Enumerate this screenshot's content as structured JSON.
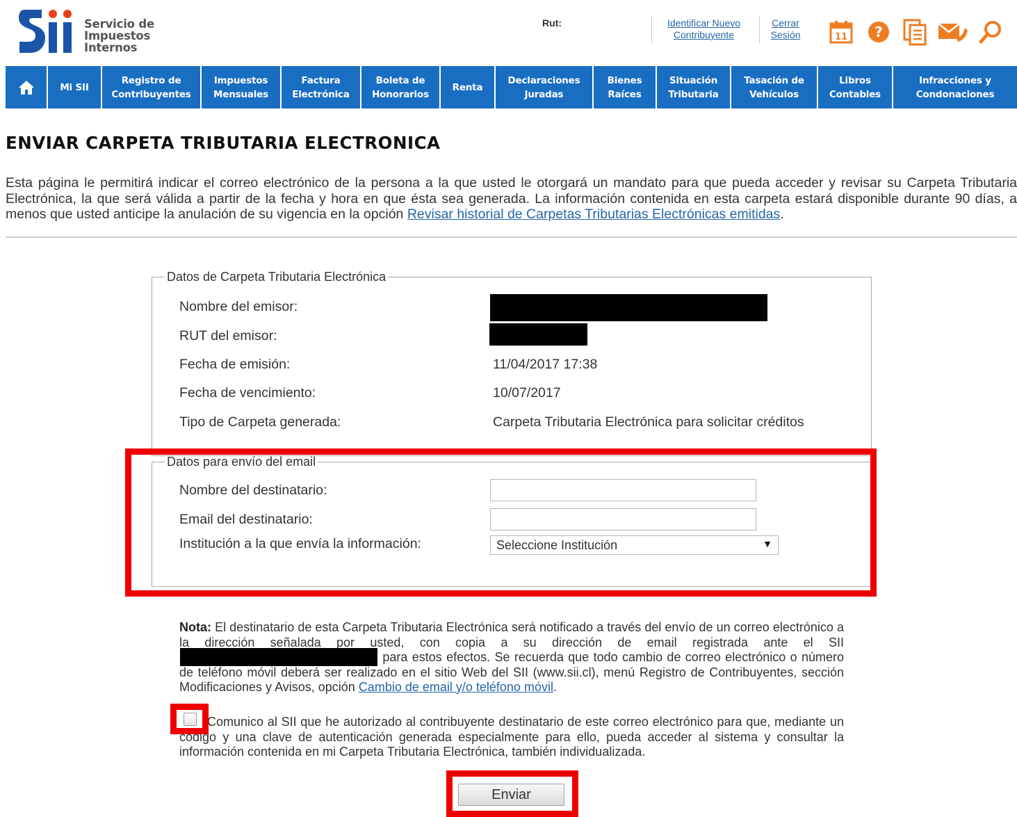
{
  "header": {
    "logo_text": [
      "Servicio de",
      "Impuestos",
      "Internos"
    ],
    "rut_label": "Rut:",
    "identify_link": [
      "Identificar Nuevo",
      "Contribuyente"
    ],
    "logout_link": [
      "Cerrar",
      "Sesión"
    ],
    "icons": [
      "calendar-icon",
      "help-icon",
      "documents-icon",
      "mail-icon",
      "search-icon"
    ],
    "icon_color": "#ee7d22"
  },
  "nav": {
    "color": "#1a6ec1",
    "items": [
      {
        "label": "",
        "icon": "home-icon"
      },
      {
        "label": "Mi SII"
      },
      {
        "label": "Registro de\nContribuyentes"
      },
      {
        "label": "Impuestos\nMensuales"
      },
      {
        "label": "Factura\nElectrónica"
      },
      {
        "label": "Boleta de\nHonorarios"
      },
      {
        "label": "Renta"
      },
      {
        "label": "Declaraciones\nJuradas"
      },
      {
        "label": "Bienes\nRaíces"
      },
      {
        "label": "Situación\nTributaria"
      },
      {
        "label": "Tasación de\nVehículos"
      },
      {
        "label": "Libros\nContables"
      },
      {
        "label": "Infracciones y\nCondonaciones"
      }
    ]
  },
  "page": {
    "title": "ENVIAR CARPETA TRIBUTARIA ELECTRONICA",
    "intro_text": "Esta página le permitirá indicar el correo electrónico de la persona a la que usted le otorgará un mandato para que pueda acceder y revisar su Carpeta Tributaria Electrónica, la que será válida a partir de la fecha y hora en que ésta sea generada. La información contenida en esta carpeta estará disponible durante 90 días, a menos que usted anticipe la anulación de su vigencia en la opción ",
    "intro_link": "Revisar historial de Carpetas Tributarias Electrónicas emitidas",
    "intro_end": "."
  },
  "carpeta": {
    "legend": "Datos de Carpeta Tributaria Electrónica",
    "emisor_label": "Nombre del emisor:",
    "rut_label": "RUT del emisor:",
    "fecha_emision_label": "Fecha de emisión:",
    "fecha_emision": "11/04/2017 17:38",
    "fecha_venc_label": "Fecha de vencimiento:",
    "fecha_venc": "10/07/2017",
    "tipo_label": "Tipo de Carpeta generada:",
    "tipo": "Carpeta Tributaria Electrónica para solicitar créditos"
  },
  "email": {
    "legend": "Datos para envío del email",
    "nombre_label": "Nombre del destinatario:",
    "nombre_value": "",
    "email_label": "Email del destinatario:",
    "email_value": "",
    "institucion_label": "Institución a la que envía la información:",
    "institucion_selected": "Seleccione Institución"
  },
  "note": {
    "bold": "Nota:",
    "text_1": " El destinatario de esta Carpeta Tributaria Electrónica será notificado a través del envío de un correo electrónico a la dirección señalada por usted, con copia a su dirección de email registrada ante el SII ",
    "text_2": " para estos efectos. Se recuerda que todo cambio de correo electrónico o número de teléfono móvil deberá ser realizado en el sitio Web del SII (www.sii.cl), menú Registro de Contribuyentes, sección Modificaciones y Avisos, opción ",
    "link": "Cambio de email y/o teléfono móvil",
    "end": "."
  },
  "consent": {
    "checked": false,
    "text": "Comunico al SII que he autorizado al contribuyente destinatario de este correo electrónico para que, mediante un código y una clave de autenticación generada especialmente para ello, pueda acceder al sistema y consultar la información contenida en mi Carpeta Tributaria Electrónica, también individualizada."
  },
  "submit_label": "Enviar",
  "highlight_color": "#ee0000"
}
